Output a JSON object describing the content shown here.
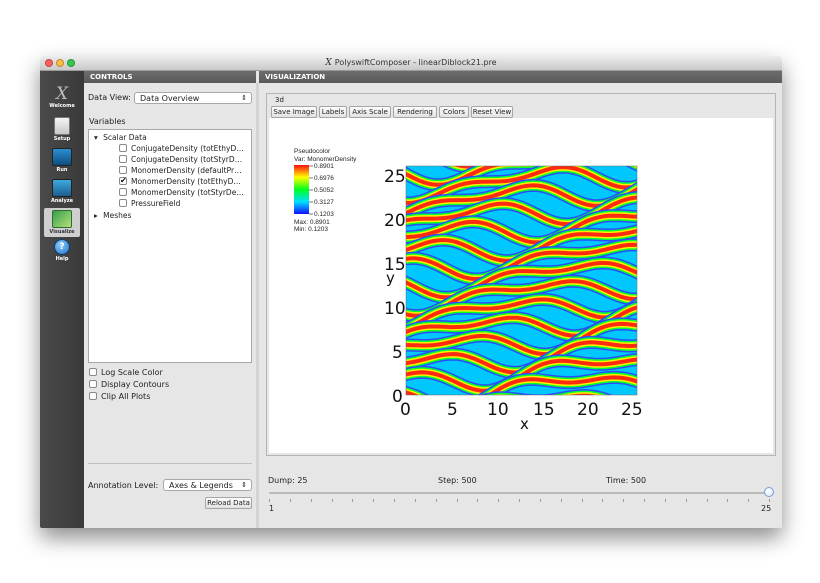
{
  "window": {
    "title": "PolyswiftComposer - linearDiblock21.pre",
    "logo_glyph": "X"
  },
  "toolbar": {
    "items": [
      {
        "label": "Welcome",
        "icon": "x-logo-icon"
      },
      {
        "label": "Setup",
        "icon": "setup-icon"
      },
      {
        "label": "Run",
        "icon": "run-icon"
      },
      {
        "label": "Analyze",
        "icon": "analyze-icon"
      },
      {
        "label": "Visualize",
        "icon": "visualize-icon",
        "active": true
      },
      {
        "label": "Help",
        "icon": "help-icon"
      }
    ]
  },
  "controls": {
    "header": "CONTROLS",
    "data_view_label": "Data View:",
    "data_view_value": "Data Overview",
    "variables_label": "Variables",
    "tree": {
      "scalar_group": "Scalar Data",
      "items": [
        {
          "label": "ConjugateDensity (totEthyD…",
          "checked": false
        },
        {
          "label": "ConjugateDensity (totStyrD…",
          "checked": false
        },
        {
          "label": "MonomerDensity (defaultPr…",
          "checked": false
        },
        {
          "label": "MonomerDensity (totEthyD…",
          "checked": true
        },
        {
          "label": "MonomerDensity (totStyrDe…",
          "checked": false
        },
        {
          "label": "PressureField",
          "checked": false
        }
      ],
      "meshes_group": "Meshes"
    },
    "options": [
      "Log Scale Color",
      "Display Contours",
      "Clip All Plots"
    ],
    "annotation_label": "Annotation Level:",
    "annotation_value": "Axes & Legends",
    "reload_button": "Reload Data"
  },
  "visualization": {
    "header": "VISUALIZATION",
    "tab_label": "3d",
    "buttons": [
      "Save Image",
      "Labels",
      "Axis Scale",
      "Rendering",
      "Colors",
      "Reset View"
    ],
    "legend": {
      "line1": "Pseudocolor",
      "line2": "Var: MonomerDensity",
      "ticks": [
        "0.8901",
        "0.6976",
        "0.5052",
        "0.3127",
        "0.1203"
      ],
      "max_text": "Max: 0.8901",
      "min_text": "Min: 0.1203"
    },
    "plot": {
      "x_ticks": [
        "0",
        "5",
        "10",
        "15",
        "20",
        "25"
      ],
      "y_ticks": [
        "0",
        "5",
        "10",
        "15",
        "20",
        "25"
      ],
      "xlabel": "x",
      "ylabel": "y"
    },
    "dump_text": "Dump: 25",
    "step_text": "Step: 500",
    "time_text": "Time: 500",
    "slider": {
      "min_label": "1",
      "max_label": "25",
      "value": 25,
      "min": 1,
      "max": 25
    }
  }
}
